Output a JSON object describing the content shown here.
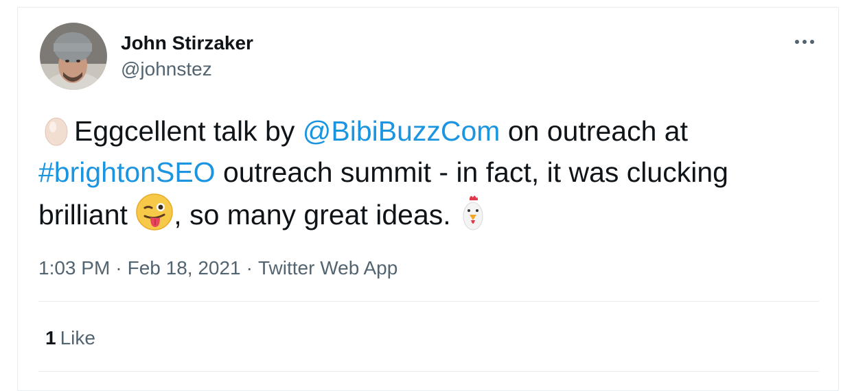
{
  "author": {
    "name": "John Stirzaker",
    "handle": "@johnstez"
  },
  "tweet": {
    "line1": {
      "before": "Eggcellent talk by ",
      "mention": "@BibiBuzzCom",
      "after": " on outreach at"
    },
    "line2": {
      "hashtag": "#brightonSEO",
      "after": " outreach summit  - in fact, it was clucking"
    },
    "line3": {
      "before": "brilliant ",
      "after": ", so many great ideas. "
    },
    "emojis": [
      "egg-icon",
      "winking-tongue-face-icon",
      "chicken-icon"
    ]
  },
  "meta": {
    "time": "1:03 PM",
    "separator": "·",
    "date": "Feb 18, 2021",
    "source": "Twitter Web App"
  },
  "engagement": {
    "like_count": "1",
    "like_label": "Like"
  },
  "colors": {
    "link": "#1b95e0",
    "secondary_text": "#536471",
    "border": "#e6ecf0"
  }
}
